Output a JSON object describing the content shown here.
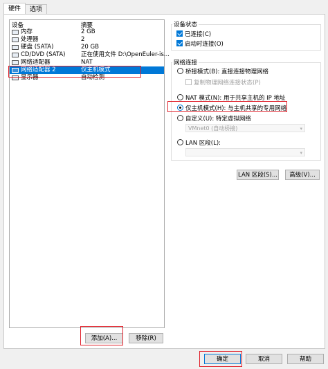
{
  "tabs": [
    {
      "label": "硬件"
    },
    {
      "label": "选项"
    }
  ],
  "device_list": {
    "headers": {
      "device": "设备",
      "summary": "摘要"
    },
    "rows": [
      {
        "name": "内存",
        "summary": "2 GB",
        "icon": "memory-icon"
      },
      {
        "name": "处理器",
        "summary": "2",
        "icon": "cpu-icon"
      },
      {
        "name": "硬盘 (SATA)",
        "summary": "20 GB",
        "icon": "harddisk-icon"
      },
      {
        "name": "CD/DVD (SATA)",
        "summary": "正在使用文件 D:\\OpenEuler-is...",
        "icon": "cdrom-icon"
      },
      {
        "name": "网络适配器",
        "summary": "NAT",
        "icon": "network-adapter-icon"
      },
      {
        "name": "网络适配器 2",
        "summary": "仅主机模式",
        "icon": "network-adapter-icon",
        "selected": true
      },
      {
        "name": "显示器",
        "summary": "自动检测",
        "icon": "display-icon"
      }
    ]
  },
  "buttons": {
    "add": "添加(A)...",
    "remove": "移除(R)",
    "lan_segment": "LAN 区段(S)...",
    "advanced": "高级(V)...",
    "ok": "确定",
    "cancel": "取消",
    "help": "帮助"
  },
  "device_status": {
    "title": "设备状态",
    "connected": {
      "label": "已连接(C)",
      "checked": true
    },
    "connect_at_power_on": {
      "label": "启动时连接(O)",
      "checked": true
    }
  },
  "network_connection": {
    "title": "网络连接",
    "bridged": {
      "label": "桥接模式(B): 直接连接物理网络",
      "selected": false
    },
    "replicate_state": {
      "label": "复制物理网络连接状态(P)",
      "checked": false
    },
    "nat": {
      "label": "NAT 模式(N): 用于共享主机的 IP 地址",
      "selected": false
    },
    "host_only": {
      "label": "仅主机模式(H): 与主机共享的专用网络",
      "selected": true
    },
    "custom": {
      "label": "自定义(U): 特定虚拟网络",
      "selected": false
    },
    "custom_value": "VMnet0 (自动桥接)",
    "lan_segment": {
      "label": "LAN 区段(L):",
      "selected": false
    },
    "lan_segment_value": ""
  },
  "colors": {
    "selection": "#0078d7",
    "highlight_box": "#e0202a"
  }
}
